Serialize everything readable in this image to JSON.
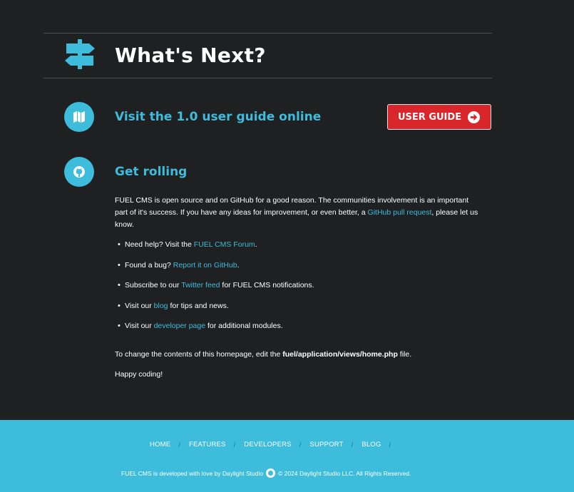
{
  "hero": {
    "title": "What's Next?",
    "icon": "signpost-icon"
  },
  "guide": {
    "title": "Visit the 1.0 user guide online",
    "icon": "map-icon",
    "button_label": "USER GUIDE",
    "button_icon": "arrow-right-circle-icon"
  },
  "rolling": {
    "title": "Get rolling",
    "icon": "github-icon",
    "intro_text": "FUEL CMS is open source and on GitHub for a good reason. The communities involvement is an important part of it's success. If you have any ideas for improvement, or even better, a",
    "intro_link": "GitHub pull request",
    "intro_end": ", please let us know.",
    "bullets": [
      {
        "pre": "Need help? Visit the",
        "link": "FUEL CMS Forum",
        "post": "."
      },
      {
        "pre": "Found a bug?",
        "link": "Report it on GitHub",
        "post": "."
      },
      {
        "pre": "Subscribe to our",
        "link": "Twitter feed",
        "post": "for FUEL CMS notifications."
      },
      {
        "pre": "Visit our",
        "link": "blog",
        "post": "for tips and news."
      },
      {
        "pre": "Visit our",
        "link": "developer page",
        "post": "for additional modules."
      }
    ],
    "change_pre": "To change the contents of this homepage, edit the",
    "change_path": "fuel/application/views/home.php",
    "change_post": "file.",
    "closing": "Happy coding!"
  },
  "footer": {
    "nav": [
      "HOME",
      "FEATURES",
      "DEVELOPERS",
      "SUPPORT",
      "BLOG"
    ],
    "separator": "/",
    "credit_pre": "FUEL CMS is developed with love by Daylight Studio",
    "credit_post": "© 2024 Daylight Studio LLC. All Rights Reserved."
  },
  "colors": {
    "accent": "#3dbcdc",
    "button": "#d8262b",
    "background": "#1f2022"
  }
}
